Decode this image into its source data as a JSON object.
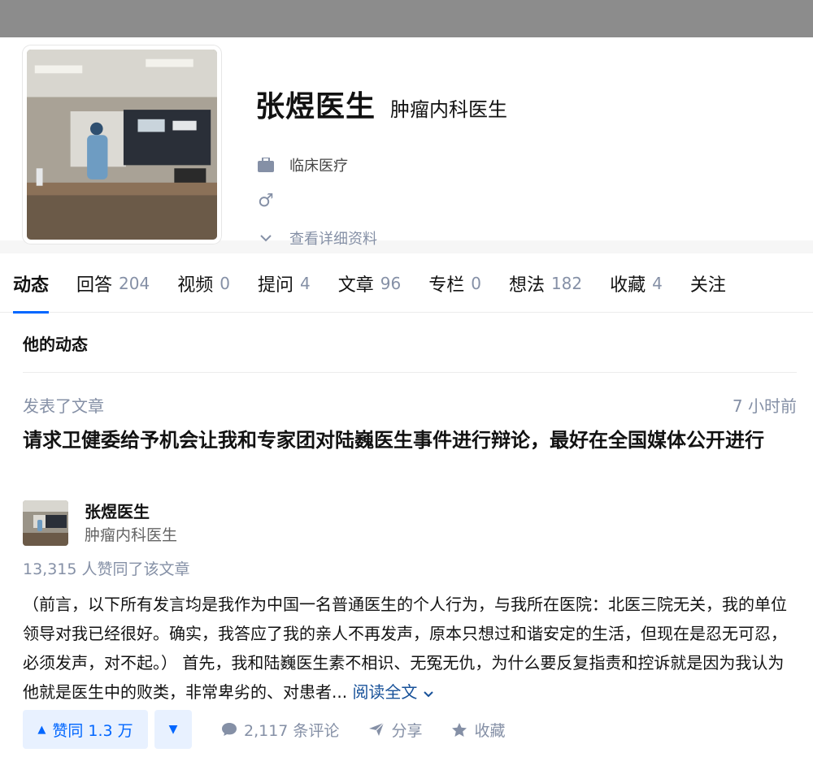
{
  "profile": {
    "name": "张煜医生",
    "headline": "肿瘤内科医生",
    "industry": "临床医疗",
    "gender_symbol": "♂",
    "more_info_label": "查看详细资料"
  },
  "tabs": [
    {
      "label": "动态",
      "count": ""
    },
    {
      "label": "回答",
      "count": "204"
    },
    {
      "label": "视频",
      "count": "0"
    },
    {
      "label": "提问",
      "count": "4"
    },
    {
      "label": "文章",
      "count": "96"
    },
    {
      "label": "专栏",
      "count": "0"
    },
    {
      "label": "想法",
      "count": "182"
    },
    {
      "label": "收藏",
      "count": "4"
    },
    {
      "label": "关注",
      "count": ""
    }
  ],
  "activity": {
    "section_title": "他的动态",
    "item": {
      "meta": "发表了文章",
      "time": "7 小时前",
      "title": "请求卫健委给予机会让我和专家团对陆巍医生事件进行辩论，最好在全国媒体公开进行",
      "author_name": "张煜医生",
      "author_headline": "肿瘤内科医生",
      "vote_summary": "13,315 人赞同了该文章",
      "excerpt": "（前言，以下所有发言均是我作为中国一名普通医生的个人行为，与我所在医院：北医三院无关，我的单位领导对我已经很好。确实，我答应了我的亲人不再发声，原本只想过和谐安定的生活，但现在是忍无可忍，必须发声，对不起。） 首先，我和陆巍医生素不相识、无冤无仇，为什么要反复指责和控诉就是因为我认为他就是医生中的败类，非常卑劣的、对患者...",
      "read_more": "阅读全文",
      "vote_label": "赞同 1.3 万",
      "comments_label": "2,117 条评论",
      "share_label": "分享",
      "collect_label": "收藏"
    }
  },
  "colors": {
    "accent": "#0066ff",
    "muted": "#8590a6",
    "link": "#175199"
  }
}
